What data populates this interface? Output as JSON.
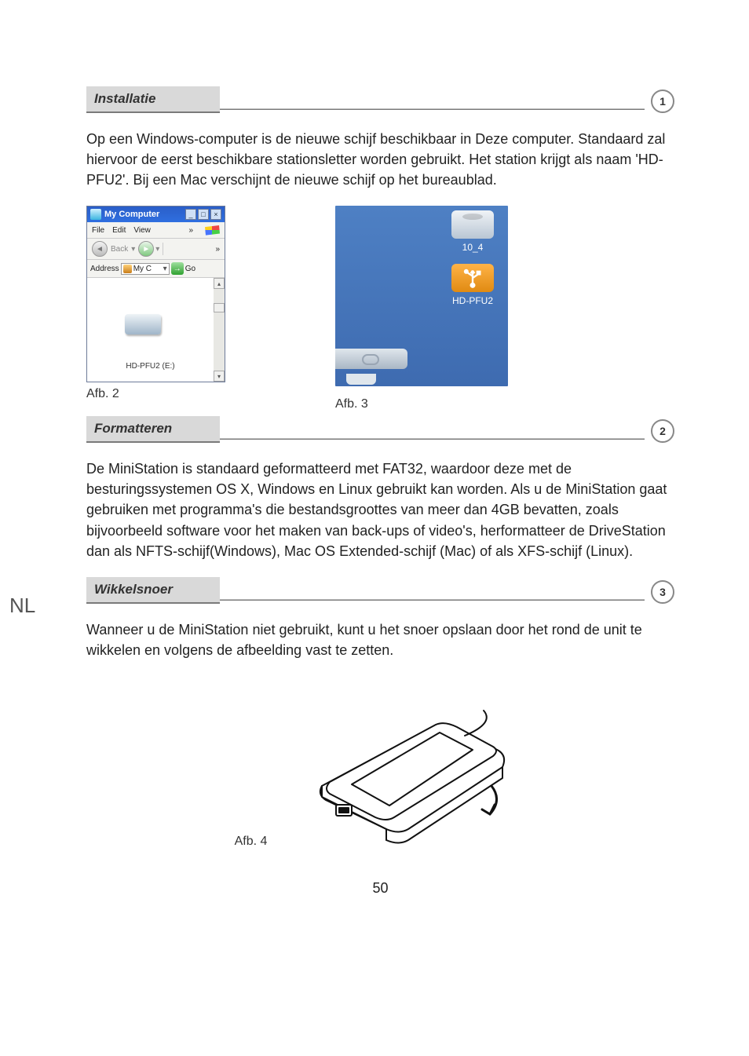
{
  "page_number": "50",
  "side_language": "NL",
  "sections": [
    {
      "title": "Installatie",
      "step": "1",
      "body": "Op een Windows-computer is de nieuwe schijf beschikbaar in Deze computer. Standaard zal hiervoor de eerst beschikbare stationsletter worden gebruikt. Het station krijgt als naam 'HD-PFU2'. Bij een Mac verschijnt de nieuwe schijf op het bureaublad.",
      "figures": {
        "fig2": {
          "caption": "Afb. 2",
          "window_title": "My Computer",
          "menu": [
            "File",
            "Edit",
            "View"
          ],
          "back_label": "Back",
          "address_label": "Address",
          "address_value": "My C",
          "go_label": "Go",
          "drive_label": "HD-PFU2 (E:)"
        },
        "fig3": {
          "caption": "Afb. 3",
          "hdd_label": "10_4",
          "usb_label": "HD-PFU2"
        }
      }
    },
    {
      "title": "Formatteren",
      "step": "2",
      "body": "De MiniStation is standaard geformatteerd met FAT32, waardoor deze met de besturingssystemen OS X, Windows en Linux gebruikt kan worden. Als u de MiniStation gaat gebruiken met programma's die bestandsgroottes van meer dan 4GB bevatten, zoals bijvoorbeeld software voor het maken van back-ups of video's, herformatteer de DriveStation dan als NFTS-schijf(Windows), Mac OS Extended-schijf (Mac) of als XFS-schijf (Linux)."
    },
    {
      "title": "Wikkelsnoer",
      "step": "3",
      "body": "Wanneer u de MiniStation niet gebruikt, kunt u het snoer opslaan door het rond de unit te wikkelen en volgens de afbeelding vast te zetten.",
      "figure_caption": "Afb. 4"
    }
  ]
}
